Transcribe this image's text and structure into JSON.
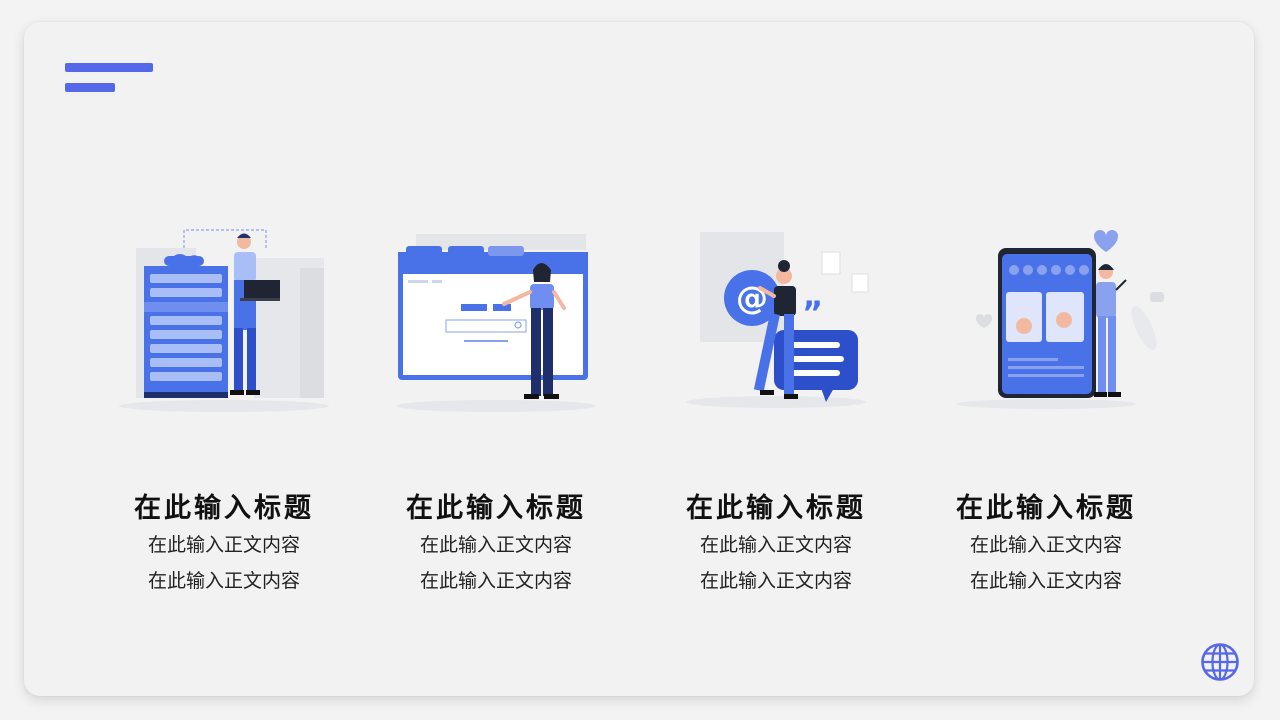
{
  "colors": {
    "accent": "#5468e9",
    "blue": "#4a72e8",
    "navy": "#1f2f6b",
    "background": "#f2f2f3"
  },
  "features": [
    {
      "icon": "server-engineer-illustration",
      "title": "在此输入标题",
      "line1": "在此输入正文内容",
      "line2": "在此输入正文内容"
    },
    {
      "icon": "browser-search-illustration",
      "title": "在此输入标题",
      "line1": "在此输入正文内容",
      "line2": "在此输入正文内容"
    },
    {
      "icon": "email-chat-illustration",
      "title": "在此输入标题",
      "line1": "在此输入正文内容",
      "line2": "在此输入正文内容"
    },
    {
      "icon": "mobile-social-illustration",
      "title": "在此输入标题",
      "line1": "在此输入正文内容",
      "line2": "在此输入正文内容"
    }
  ],
  "footer_icon": "globe-icon"
}
